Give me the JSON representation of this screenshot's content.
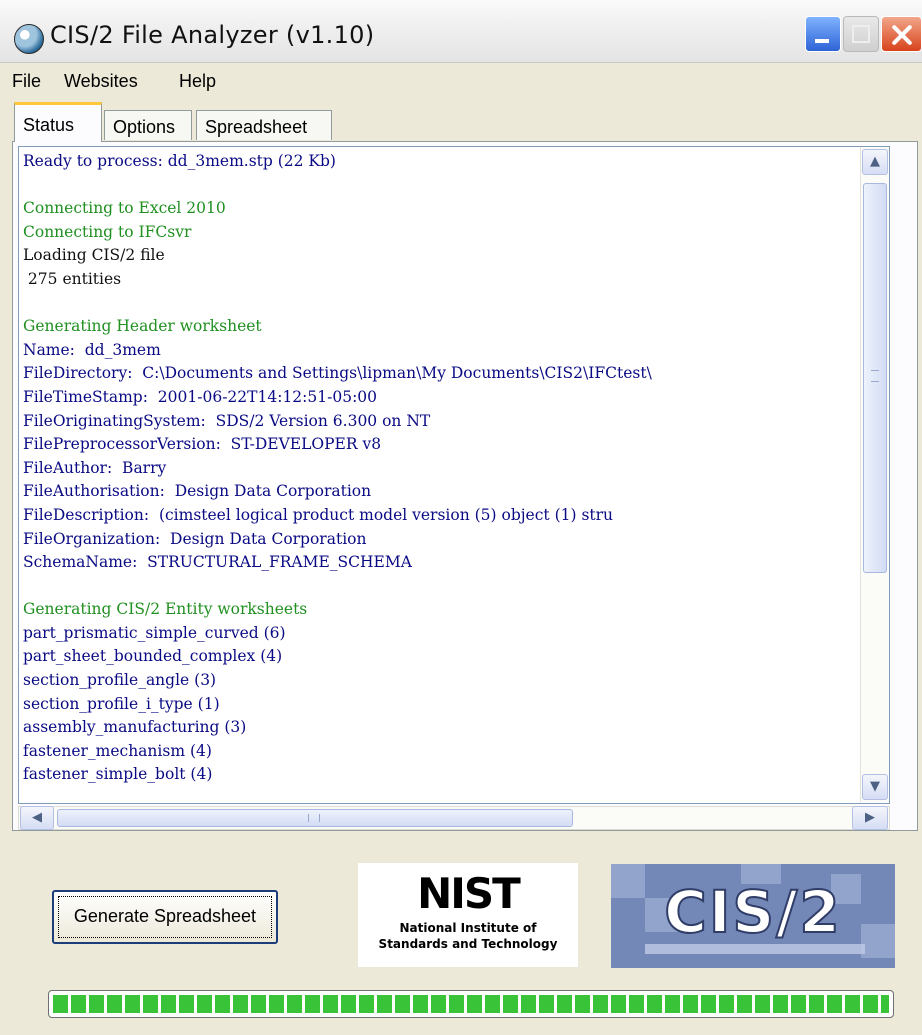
{
  "window": {
    "title": "CIS/2 File Analyzer  (v1.10)"
  },
  "menu": [
    "File",
    "Websites",
    "Help"
  ],
  "tabs": [
    "Status",
    "Options",
    "Spreadsheet"
  ],
  "active_tab": "Status",
  "log": [
    {
      "text": "Ready to process: dd_3mem.stp (22 Kb)",
      "color": "#0a0a84"
    },
    {
      "text": "",
      "color": "#0a0a84"
    },
    {
      "text": "Connecting to Excel 2010",
      "color": "#209020"
    },
    {
      "text": "Connecting to IFCsvr",
      "color": "#209020"
    },
    {
      "text": "Loading CIS/2 file",
      "color": "#111111"
    },
    {
      "text": " 275 entities",
      "color": "#111111"
    },
    {
      "text": "",
      "color": "#111111"
    },
    {
      "text": "Generating Header worksheet",
      "color": "#209020"
    },
    {
      "text": "Name:  dd_3mem",
      "color": "#0a0a84"
    },
    {
      "text": "FileDirectory:  C:\\Documents and Settings\\lipman\\My Documents\\CIS2\\IFCtest\\",
      "color": "#0a0a84"
    },
    {
      "text": "FileTimeStamp:  2001-06-22T14:12:51-05:00",
      "color": "#0a0a84"
    },
    {
      "text": "FileOriginatingSystem:  SDS/2 Version 6.300 on NT",
      "color": "#0a0a84"
    },
    {
      "text": "FilePreprocessorVersion:  ST-DEVELOPER v8",
      "color": "#0a0a84"
    },
    {
      "text": "FileAuthor:  Barry",
      "color": "#0a0a84"
    },
    {
      "text": "FileAuthorisation:  Design Data Corporation",
      "color": "#0a0a84"
    },
    {
      "text": "FileDescription:  (cimsteel logical product model version (5) object (1) stru",
      "color": "#0a0a84"
    },
    {
      "text": "FileOrganization:  Design Data Corporation",
      "color": "#0a0a84"
    },
    {
      "text": "SchemaName:  STRUCTURAL_FRAME_SCHEMA",
      "color": "#0a0a84"
    },
    {
      "text": "",
      "color": "#0a0a84"
    },
    {
      "text": "Generating CIS/2 Entity worksheets",
      "color": "#209020"
    },
    {
      "text": "part_prismatic_simple_curved (6)",
      "color": "#0a0a84"
    },
    {
      "text": "part_sheet_bounded_complex (4)",
      "color": "#0a0a84"
    },
    {
      "text": "section_profile_angle (3)",
      "color": "#0a0a84"
    },
    {
      "text": "section_profile_i_type (1)",
      "color": "#0a0a84"
    },
    {
      "text": "assembly_manufacturing (3)",
      "color": "#0a0a84"
    },
    {
      "text": "fastener_mechanism (4)",
      "color": "#0a0a84"
    },
    {
      "text": "fastener_simple_bolt (4)",
      "color": "#0a0a84"
    }
  ],
  "generate_button": "Generate Spreadsheet",
  "nist_logo": {
    "mark": "NIST",
    "line1": "National Institute of",
    "line2": "Standards and Technology"
  },
  "cis_logo": "CIS/2",
  "progress": 1.0
}
